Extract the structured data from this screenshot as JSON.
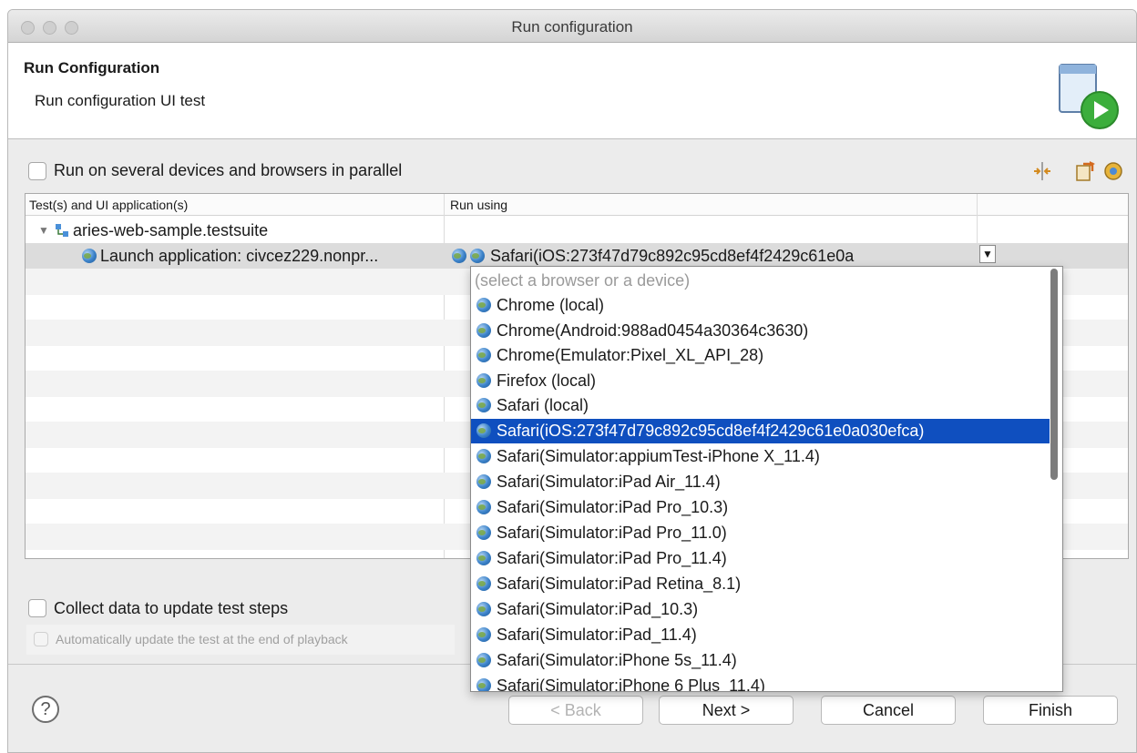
{
  "window": {
    "title": "Run configuration"
  },
  "header": {
    "title": "Run Configuration",
    "subtitle": "Run configuration  UI test"
  },
  "options": {
    "parallel_label": "Run on several devices and browsers in parallel",
    "collect_label": "Collect data to update test steps",
    "auto_update_label": "Automatically update the test at the end of playback"
  },
  "table": {
    "columns": [
      "Test(s) and UI application(s)",
      "Run using"
    ],
    "suite_name": "aries-web-sample.testsuite",
    "launch_label": "Launch application: civcez229.nonpr...",
    "run_using_value": "Safari(iOS:273f47d79c892c95cd8ef4f2429c61e0a"
  },
  "dropdown": {
    "placeholder": "(select a browser or a device)",
    "items": [
      "Chrome (local)",
      "Chrome(Android:988ad0454a30364c3630)",
      "Chrome(Emulator:Pixel_XL_API_28)",
      "Firefox (local)",
      "Safari (local)",
      "Safari(iOS:273f47d79c892c95cd8ef4f2429c61e0a030efca)",
      "Safari(Simulator:appiumTest-iPhone X_11.4)",
      "Safari(Simulator:iPad Air_11.4)",
      "Safari(Simulator:iPad Pro_10.3)",
      "Safari(Simulator:iPad Pro_11.0)",
      "Safari(Simulator:iPad Pro_11.4)",
      "Safari(Simulator:iPad Retina_8.1)",
      "Safari(Simulator:iPad_10.3)",
      "Safari(Simulator:iPad_11.4)",
      "Safari(Simulator:iPhone 5s_11.4)",
      "Safari(Simulator:iPhone 6 Plus_11.4)"
    ],
    "selected_item": "Safari(iOS:273f47d79c892c95cd8ef4f2429c61e0a030efca)"
  },
  "buttons": {
    "help": "?",
    "back": "< Back",
    "next": "Next >",
    "cancel": "Cancel",
    "finish": "Finish"
  },
  "colors": {
    "selection": "#0f4fbf",
    "run_icon": "#3cae3c"
  }
}
